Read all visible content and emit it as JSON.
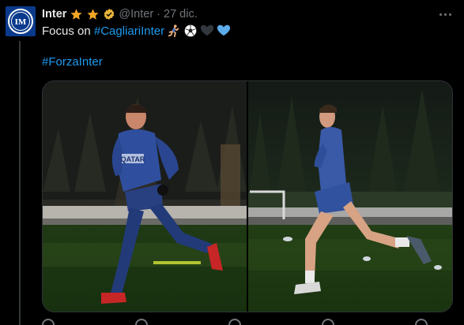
{
  "tweet": {
    "author_name": "Inter",
    "handle": "@Inter",
    "separator": "·",
    "date": "27 dic.",
    "text_prefix": "Focus on ",
    "hashtag_1": "#CagliariInter",
    "hashtag_2": "#ForzaInter",
    "badges": [
      "star-icon",
      "star-icon",
      "verified-icon"
    ],
    "emojis": [
      "running-man-emoji",
      "soccer-ball-emoji",
      "black-heart-emoji",
      "blue-heart-emoji"
    ]
  },
  "media": {
    "photos": [
      {
        "name": "photo-player-running-left",
        "jersey_text": "QATAR"
      },
      {
        "name": "photo-player-running-right"
      }
    ]
  },
  "colors": {
    "background": "#000000",
    "text": "#e7e9ea",
    "muted": "#71767b",
    "link": "#1d9bf0",
    "star": "#f4a623",
    "inter_blue": "#0a3a8c",
    "kit_blue": "#2f4f9e"
  }
}
